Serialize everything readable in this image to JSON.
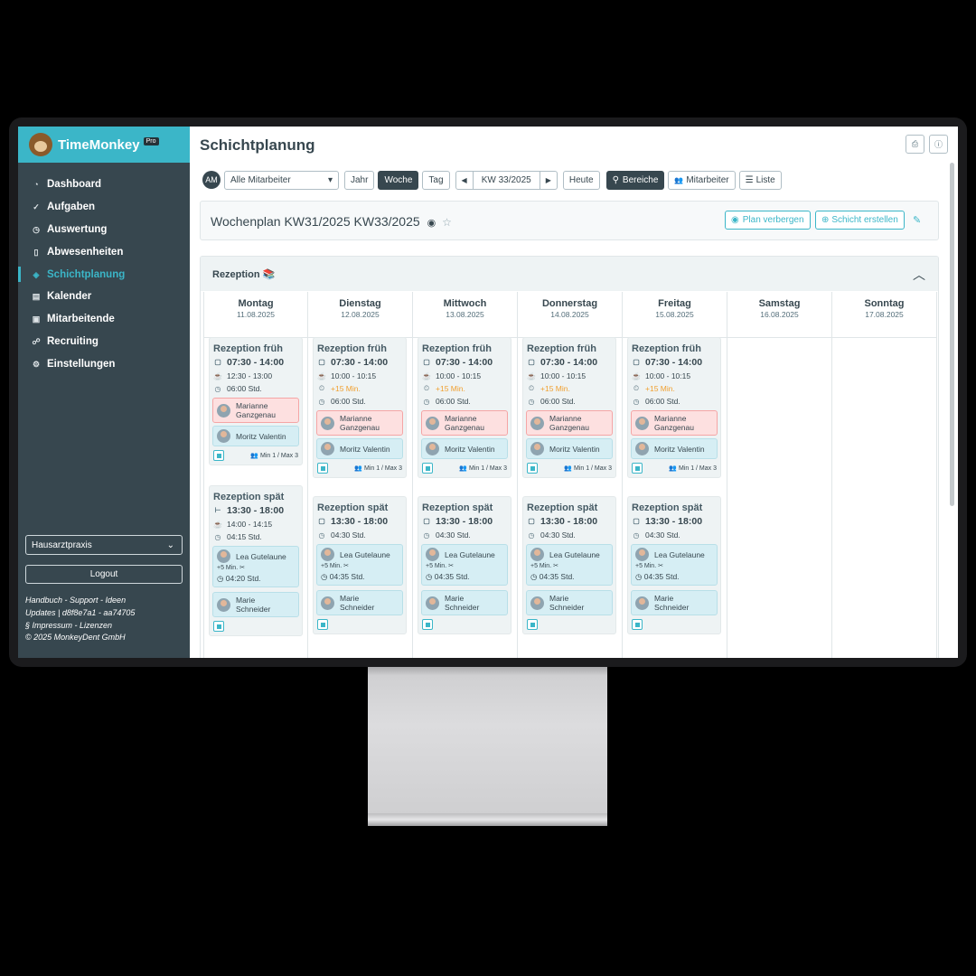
{
  "sidebar": {
    "brand": "TimeMonkey",
    "badge": "Pro",
    "items": [
      {
        "label": "Dashboard",
        "icon": "dashboard-icon",
        "glyph": "◔"
      },
      {
        "label": "Aufgaben",
        "icon": "check-circle-icon",
        "glyph": "✓"
      },
      {
        "label": "Auswertung",
        "icon": "clock-icon",
        "glyph": "◷"
      },
      {
        "label": "Abwesenheiten",
        "icon": "door-icon",
        "glyph": "▯"
      },
      {
        "label": "Schichtplanung",
        "icon": "layers-icon",
        "glyph": "◈"
      },
      {
        "label": "Kalender",
        "icon": "calendar-icon",
        "glyph": "▤"
      },
      {
        "label": "Mitarbeitende",
        "icon": "id-card-icon",
        "glyph": "▣"
      },
      {
        "label": "Recruiting",
        "icon": "people-icon",
        "glyph": "☍"
      },
      {
        "label": "Einstellungen",
        "icon": "gear-icon",
        "glyph": "⚙"
      }
    ],
    "practice_select": "Hausarztpraxis",
    "logout": "Logout",
    "footer": {
      "line1": "Handbuch - Support - Ideen",
      "line2": "Updates | d8f8e7a1 - aa74705",
      "line3": "§ Impressum - Lizenzen",
      "line4": "© 2025 MonkeyDent GmbH"
    }
  },
  "header": {
    "title": "Schichtplanung",
    "print_icon": "print-icon",
    "info_icon": "info-icon"
  },
  "toolbar": {
    "avatar": "AM",
    "employee_select": "Alle Mitarbeiter",
    "year": "Jahr",
    "week": "Woche",
    "day": "Tag",
    "prev": "◀",
    "current_week": "KW 33/2025",
    "next": "▶",
    "today": "Heute",
    "areas": "Bereiche",
    "employees": "Mitarbeiter",
    "list": "Liste"
  },
  "plan": {
    "title": "Wochenplan KW31/2025 KW33/2025",
    "hide_button": "Plan verbergen",
    "create_button": "Schicht erstellen"
  },
  "section": {
    "title": "Rezeption 📚",
    "days": [
      {
        "name": "Montag",
        "date": "11.08.2025"
      },
      {
        "name": "Dienstag",
        "date": "12.08.2025"
      },
      {
        "name": "Mittwoch",
        "date": "13.08.2025"
      },
      {
        "name": "Donnerstag",
        "date": "14.08.2025"
      },
      {
        "name": "Freitag",
        "date": "15.08.2025"
      },
      {
        "name": "Samstag",
        "date": "16.08.2025"
      },
      {
        "name": "Sonntag",
        "date": "17.08.2025"
      }
    ],
    "early": {
      "title": "Rezeption früh",
      "time": "07:30 - 14:00",
      "break_mon": "12:30 - 13:00",
      "break": "10:00 - 10:15",
      "extra": "+15 Min.",
      "hours": "06:00 Std.",
      "emp1_first": "Marianne",
      "emp1_last": "Ganzgenau",
      "emp2": "Moritz Valentin",
      "minmax": "Min 1 / Max 3"
    },
    "late": {
      "title": "Rezeption spät",
      "time": "13:30 - 18:00",
      "break_mon": "14:00 - 14:15",
      "hours_mon": "04:15 Std.",
      "hours": "04:30 Std.",
      "emp1": "Lea Gutelaune",
      "emp1_extra": "+5 Min.",
      "emp1_hours_mon": "04:20 Std.",
      "emp1_hours": "04:35 Std.",
      "emp2_first": "Marie",
      "emp2_last": "Schneider"
    }
  }
}
